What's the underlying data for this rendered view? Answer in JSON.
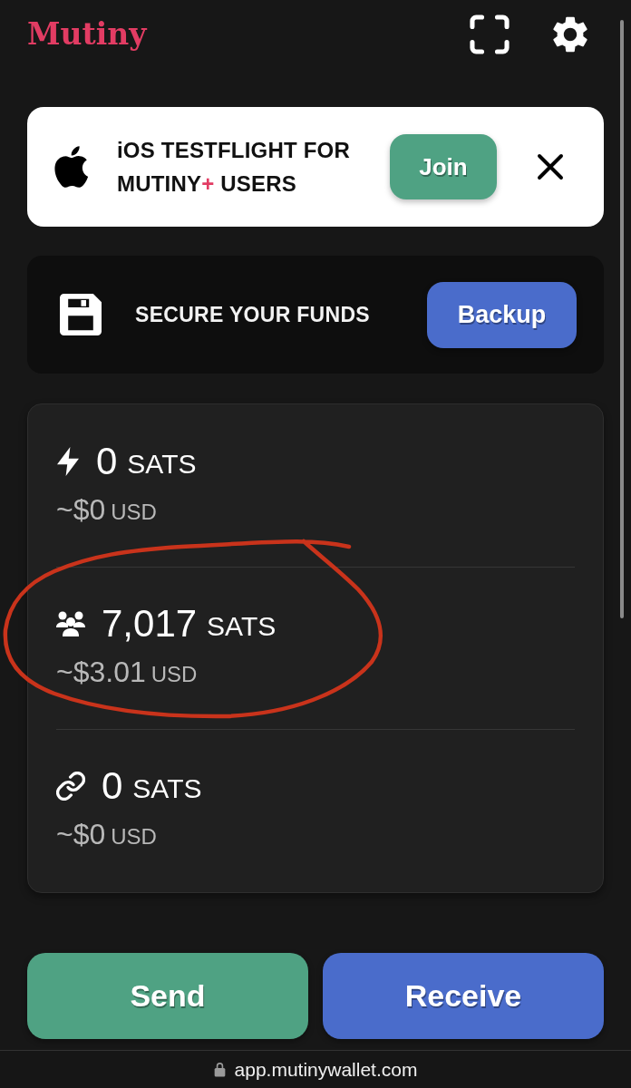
{
  "header": {
    "logo": "Mutiny"
  },
  "banner": {
    "message": [
      {
        "text": "iOS TESTFLIGHT FOR MUTINY",
        "accent": false
      },
      {
        "text": "+",
        "accent": true
      },
      {
        "text": " USERS",
        "accent": false
      }
    ],
    "button": "Join"
  },
  "backup": {
    "message": "SECURE YOUR FUNDS",
    "button": "Backup"
  },
  "balances": [
    {
      "kind": "lightning",
      "amount": "0",
      "unit": "SATS",
      "fiat": "~$0",
      "fiat_unit": "USD",
      "circled": false
    },
    {
      "kind": "federation",
      "amount": "7,017",
      "unit": "SATS",
      "fiat": "~$3.01",
      "fiat_unit": "USD",
      "circled": true
    },
    {
      "kind": "onchain",
      "amount": "0",
      "unit": "SATS",
      "fiat": "~$0",
      "fiat_unit": "USD",
      "circled": false
    }
  ],
  "actions": [
    {
      "kind": "send",
      "label": "Send"
    },
    {
      "kind": "receive",
      "label": "Receive"
    }
  ],
  "address_bar": {
    "url": "app.mutinywallet.com"
  }
}
